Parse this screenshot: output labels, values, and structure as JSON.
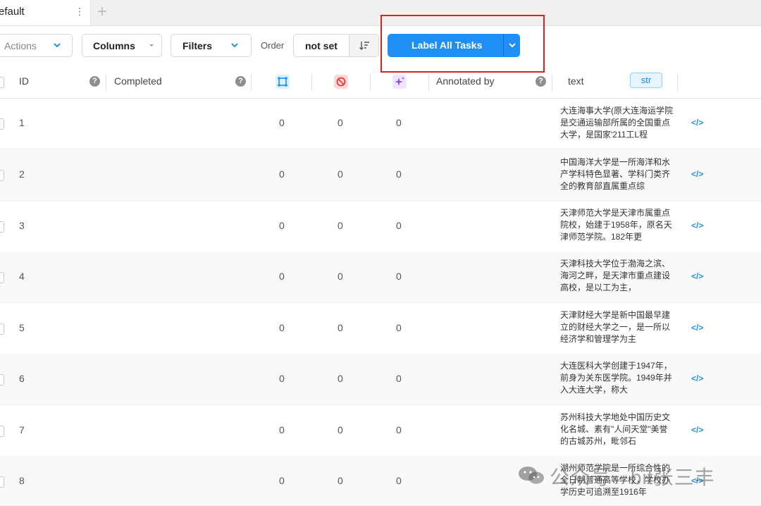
{
  "tab": {
    "name": "efault"
  },
  "toolbar": {
    "actions_label": "Actions",
    "columns_label": "Columns",
    "filters_label": "Filters",
    "order_label": "Order",
    "order_value": "not set",
    "label_all_label": "Label All Tasks"
  },
  "header": {
    "id": "ID",
    "completed": "Completed",
    "annotated_by": "Annotated by",
    "text": "text",
    "text_type": "str"
  },
  "rows": [
    {
      "id": "1",
      "c1": "0",
      "c2": "0",
      "c3": "0",
      "text": "大连海事大学(原大连海运学院是交通运输部所属的全国重点大学，是国家'211工L程"
    },
    {
      "id": "2",
      "c1": "0",
      "c2": "0",
      "c3": "0",
      "text": "中国海洋大学是一所海洋和水产学科特色显著、学科门类齐全的教育部直属重点综"
    },
    {
      "id": "3",
      "c1": "0",
      "c2": "0",
      "c3": "0",
      "text": "天津师范大学是天津市属重点院校，始建于1958年，原名天津师范学院。182年更"
    },
    {
      "id": "4",
      "c1": "0",
      "c2": "0",
      "c3": "0",
      "text": "天津科技大学位于渤海之滨、海河之畔，是天津市重点建设高校，是以工为主，"
    },
    {
      "id": "5",
      "c1": "0",
      "c2": "0",
      "c3": "0",
      "text": "天津财经大学是新中国最早建立的财经大学之一，是一所以经济学和管理学为主"
    },
    {
      "id": "6",
      "c1": "0",
      "c2": "0",
      "c3": "0",
      "text": "大连医科大学创建于1947年，前身为关东医学院。1949年并入大连大学，称大"
    },
    {
      "id": "7",
      "c1": "0",
      "c2": "0",
      "c3": "0",
      "text": "苏州科技大学地处中国历史文化名城、素有\"人间天堂\"美誉的古城苏州，毗邻石"
    },
    {
      "id": "8",
      "c1": "0",
      "c2": "0",
      "c3": "0",
      "text": "湖州师范学院是一所综合性的全日制普通高等学校，学校办学历史可追溯至1916年"
    }
  ],
  "watermark": "公众号 · bit张三丰",
  "colors": {
    "primary": "#1f8ff5",
    "highlight": "#e02020",
    "badge_bg": "#e6f5ff"
  },
  "icons": [
    "more-vertical-icon",
    "plus-icon",
    "chevron-down-icon",
    "sort-icon",
    "help-icon",
    "grid-icon",
    "ban-icon",
    "sparkle-icon",
    "code-icon"
  ]
}
